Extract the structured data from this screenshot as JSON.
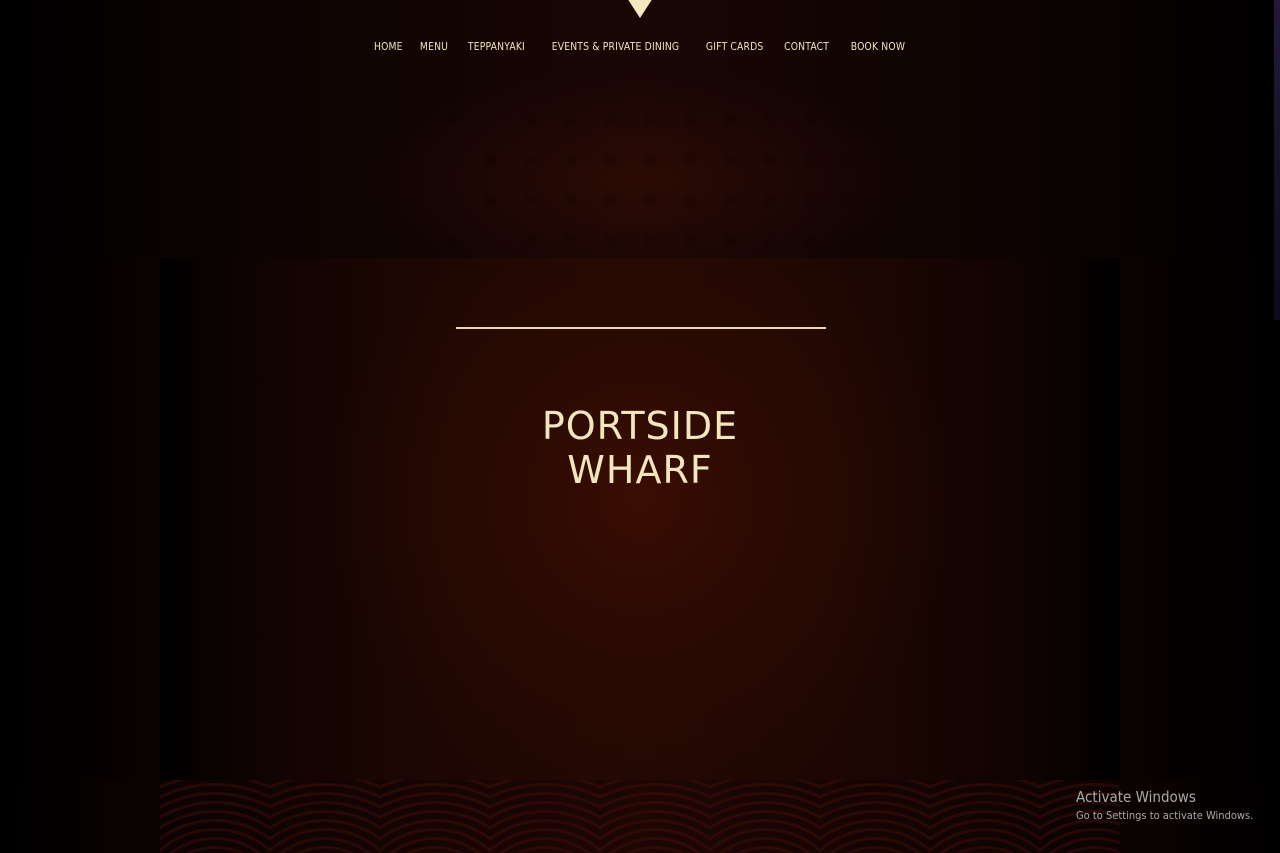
{
  "nav": {
    "items": [
      {
        "label": "HOME"
      },
      {
        "label": "MENU"
      },
      {
        "label": "TEPPANYAKI"
      },
      {
        "label": "EVENTS & PRIVATE DINING"
      },
      {
        "label": "GIFT CARDS"
      },
      {
        "label": "CONTACT"
      },
      {
        "label": "BOOK NOW"
      }
    ]
  },
  "hero": {
    "title_line1": "PORTSIDE",
    "title_line2": "WHARF"
  },
  "watermark": {
    "title": "Activate Windows",
    "subtitle": "Go to Settings to activate Windows."
  },
  "colors": {
    "accent": "#f3e6bd",
    "background": "#1f0804",
    "panel_glow": "#3a0d03"
  },
  "icons": {
    "logo": "logo-emblem-icon"
  }
}
